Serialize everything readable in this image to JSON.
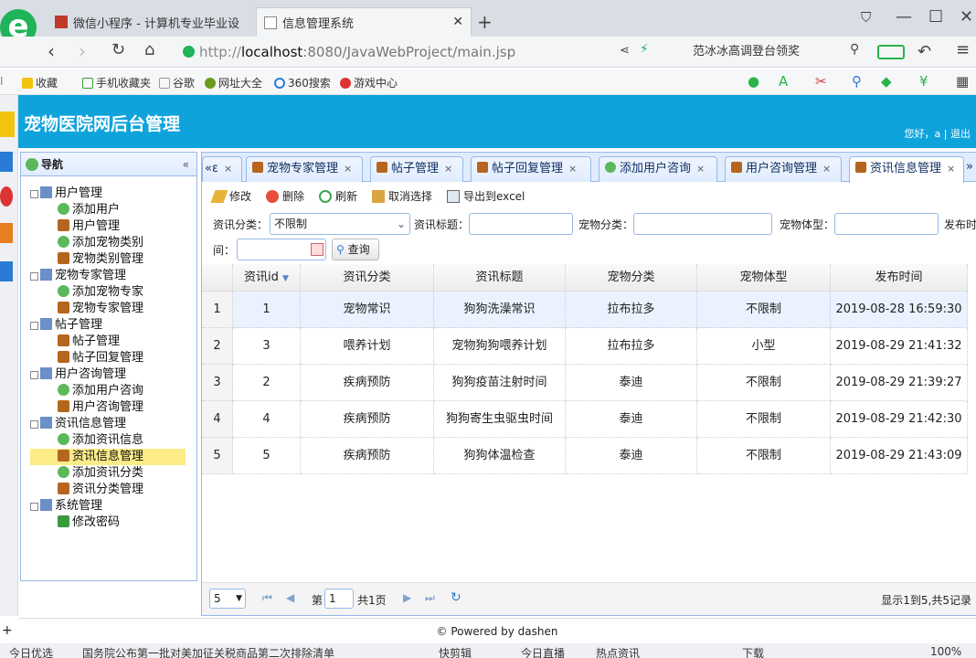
{
  "browser": {
    "tabs": [
      {
        "title": "微信小程序 - 计算机专业毕业设",
        "active": false
      },
      {
        "title": "信息管理系统",
        "active": true
      }
    ],
    "new_tab": "+",
    "url_prefix": "http://",
    "url_host": "localhost",
    "url_rest": ":8080/JavaWebProject/main.jsp",
    "search_text": "范冰冰高调登台领奖",
    "bookmarks": [
      "收藏",
      "手机收藏夹",
      "谷歌",
      "网址大全",
      "360搜索",
      "游戏中心"
    ]
  },
  "app": {
    "title": "宠物医院网后台管理",
    "user_text": "您好，a | 退出"
  },
  "nav": {
    "title": "导航",
    "groups": [
      {
        "label": "用户管理",
        "items": [
          "添加用户",
          "用户管理",
          "添加宠物类别",
          "宠物类别管理"
        ]
      },
      {
        "label": "宠物专家管理",
        "items": [
          "添加宠物专家",
          "宠物专家管理"
        ]
      },
      {
        "label": "帖子管理",
        "items": [
          "帖子管理",
          "帖子回复管理"
        ]
      },
      {
        "label": "用户咨询管理",
        "items": [
          "添加用户咨询",
          "用户咨询管理"
        ]
      },
      {
        "label": "资讯信息管理",
        "items": [
          "添加资讯信息",
          "资讯信息管理",
          "添加资讯分类",
          "资讯分类管理"
        ]
      },
      {
        "label": "系统管理",
        "items": [
          "修改密码"
        ]
      }
    ],
    "selected": "资讯信息管理"
  },
  "tabs": {
    "scroll_left": "«",
    "partial": "ε",
    "items": [
      "宠物专家管理",
      "帖子管理",
      "帖子回复管理",
      "添加用户咨询",
      "用户咨询管理",
      "资讯信息管理"
    ],
    "active": "资讯信息管理"
  },
  "toolbar": {
    "edit": "修改",
    "delete": "删除",
    "refresh": "刷新",
    "cancel_select": "取消选择",
    "export": "导出到excel"
  },
  "filters": {
    "category_label": "资讯分类：",
    "category_value": "不限制",
    "title_label": "资讯标题：",
    "pet_category_label": "宠物分类：",
    "pet_size_label": "宠物体型：",
    "publish_time_label_1": "发布时",
    "publish_time_label_2": "间：",
    "query_button": "查询"
  },
  "grid": {
    "columns": [
      "资讯id",
      "资讯分类",
      "资讯标题",
      "宠物分类",
      "宠物体型",
      "发布时间"
    ],
    "sort_indicator": "▼",
    "rows": [
      {
        "n": "1",
        "id": "1",
        "cat": "宠物常识",
        "title": "狗狗洗澡常识",
        "pet": "拉布拉多",
        "size": "不限制",
        "time": "2019-08-28 16:59:30"
      },
      {
        "n": "2",
        "id": "3",
        "cat": "喂养计划",
        "title": "宠物狗狗喂养计划",
        "pet": "拉布拉多",
        "size": "小型",
        "time": "2019-08-29 21:41:32"
      },
      {
        "n": "3",
        "id": "2",
        "cat": "疾病预防",
        "title": "狗狗疫苗注射时间",
        "pet": "泰迪",
        "size": "不限制",
        "time": "2019-08-29 21:39:27"
      },
      {
        "n": "4",
        "id": "4",
        "cat": "疾病预防",
        "title": "狗狗寄生虫驱虫时间",
        "pet": "泰迪",
        "size": "不限制",
        "time": "2019-08-29 21:42:30"
      },
      {
        "n": "5",
        "id": "5",
        "cat": "疾病预防",
        "title": "狗狗体温检查",
        "pet": "泰迪",
        "size": "不限制",
        "time": "2019-08-29 21:43:09"
      }
    ]
  },
  "pager": {
    "page_size": "5",
    "page_prefix": "第",
    "page_value": "1",
    "page_total": "共1页",
    "summary": "显示1到5,共5记录"
  },
  "footer": "© Powered by dashen",
  "statusbar": {
    "left": "今日优选",
    "news": "国务院公布第一批对美加征关税商品第二次排除清单",
    "items": [
      "快剪辑",
      "今日直播",
      "热点资讯",
      "下载",
      "100%"
    ]
  },
  "colors": {
    "header": "#0fa3dc",
    "panel_border": "#95b8e7",
    "tab_bg": "#e0ecff",
    "selected": "#fbec88"
  }
}
